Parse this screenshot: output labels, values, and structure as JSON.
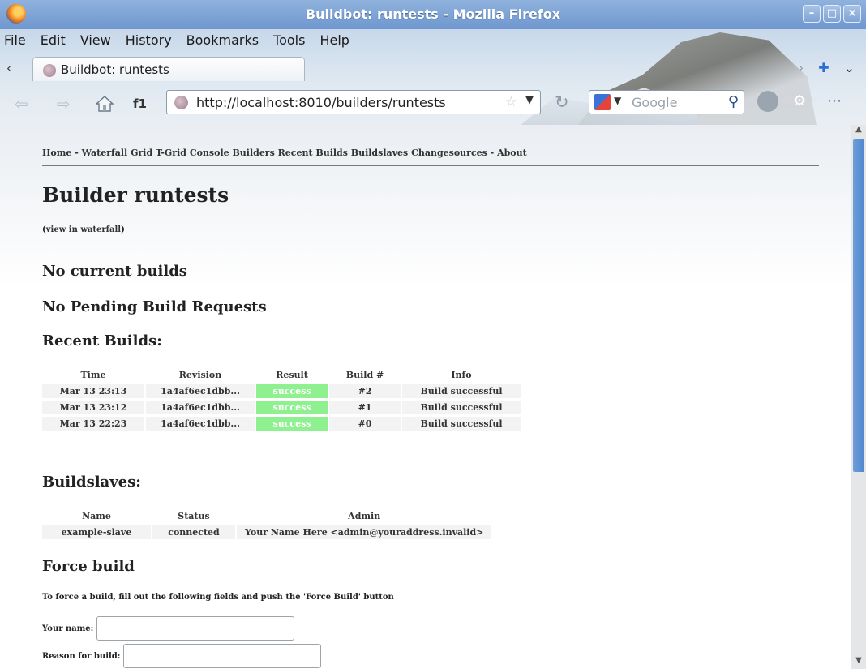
{
  "window": {
    "title": "Buildbot: runtests - Mozilla Firefox"
  },
  "menubar": {
    "items": [
      "File",
      "Edit",
      "View",
      "History",
      "Bookmarks",
      "Tools",
      "Help"
    ]
  },
  "tabs": [
    {
      "label": "Buildbot: runtests"
    }
  ],
  "navbar": {
    "bookmark_label": "f1",
    "url": "http://localhost:8010/builders/runtests",
    "search_placeholder": "Google"
  },
  "page": {
    "breadcrumbs": {
      "home": "Home",
      "sep1": " - ",
      "waterfall": "Waterfall",
      "grid": "Grid",
      "tgrid": "T-Grid",
      "console": "Console",
      "builders": "Builders",
      "recent_builds": "Recent Builds",
      "buildslaves": "Buildslaves",
      "changesources": "Changesources",
      "sep2": " - ",
      "about": "About"
    },
    "title": "Builder runtests",
    "view_in_waterfall": {
      "open": "(",
      "link": "view in waterfall",
      "close": ")"
    },
    "no_current_builds": "No current builds",
    "no_pending": "No Pending Build Requests",
    "recent_builds_heading": "Recent Builds:",
    "builds_table": {
      "headers": [
        "Time",
        "Revision",
        "Result",
        "Build #",
        "Info"
      ],
      "rows": [
        {
          "time": "Mar 13 23:13",
          "revision": "1a4af6ec1dbb...",
          "result": "success",
          "build": "#2",
          "info": "Build successful"
        },
        {
          "time": "Mar 13 23:12",
          "revision": "1a4af6ec1dbb...",
          "result": "success",
          "build": "#1",
          "info": "Build successful"
        },
        {
          "time": "Mar 13 22:23",
          "revision": "1a4af6ec1dbb...",
          "result": "success",
          "build": "#0",
          "info": "Build successful"
        }
      ]
    },
    "buildslaves_heading": "Buildslaves:",
    "slaves_table": {
      "headers": [
        "Name",
        "Status",
        "Admin"
      ],
      "rows": [
        {
          "name": "example-slave",
          "status": "connected",
          "admin": "Your Name Here <admin@youraddress.invalid>"
        }
      ]
    },
    "force_build_heading": "Force build",
    "force_build_desc": "To force a build, fill out the following fields and push the 'Force Build' button",
    "your_name_label": "Your name:",
    "your_name_value": "",
    "reason_label": "Reason for build:",
    "reason_value": ""
  },
  "colors": {
    "success": "#8ff08f",
    "titlebar": "#7fa3d6"
  }
}
